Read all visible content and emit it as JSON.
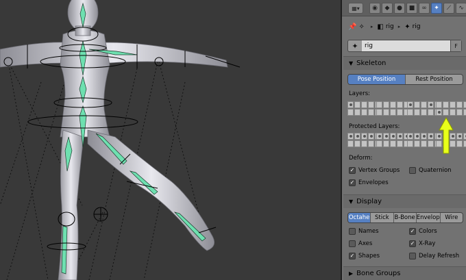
{
  "breadcrumb": {
    "armature_name": "rig",
    "object_name": "rig"
  },
  "name_field": {
    "value": "rig",
    "fake_user_label": "F"
  },
  "tabs": [
    "render-icon",
    "scene-icon",
    "world-icon",
    "object-icon",
    "constraint-icon",
    "modifier-icon",
    "data-icon",
    "bone-icon",
    "bone-constraint-icon"
  ],
  "skeleton": {
    "header": "Skeleton",
    "pose_position": "Pose Position",
    "rest_position": "Rest Position",
    "layers_label": "Layers:",
    "protected_layers_label": "Protected Layers:",
    "deform_label": "Deform:",
    "vertex_groups": "Vertex Groups",
    "quaternion": "Quaternion",
    "envelopes": "Envelopes",
    "vertex_groups_checked": true,
    "quaternion_checked": false,
    "envelopes_checked": true
  },
  "display": {
    "header": "Display",
    "modes": [
      "Octahe",
      "Stick",
      "B-Bone",
      "Envelop",
      "Wire"
    ],
    "active_mode": "Octahe",
    "names": "Names",
    "colors": "Colors",
    "axes": "Axes",
    "xray": "X-Ray",
    "shapes": "Shapes",
    "delay_refresh": "Delay Refresh",
    "names_checked": false,
    "colors_checked": true,
    "axes_checked": false,
    "xray_checked": true,
    "shapes_checked": true,
    "delay_refresh_checked": false
  },
  "bone_groups": {
    "header": "Bone Groups"
  },
  "colors": {
    "accent": "#5680c2",
    "arrow": "#e8ff1a",
    "bone": "#6ee0b0"
  }
}
